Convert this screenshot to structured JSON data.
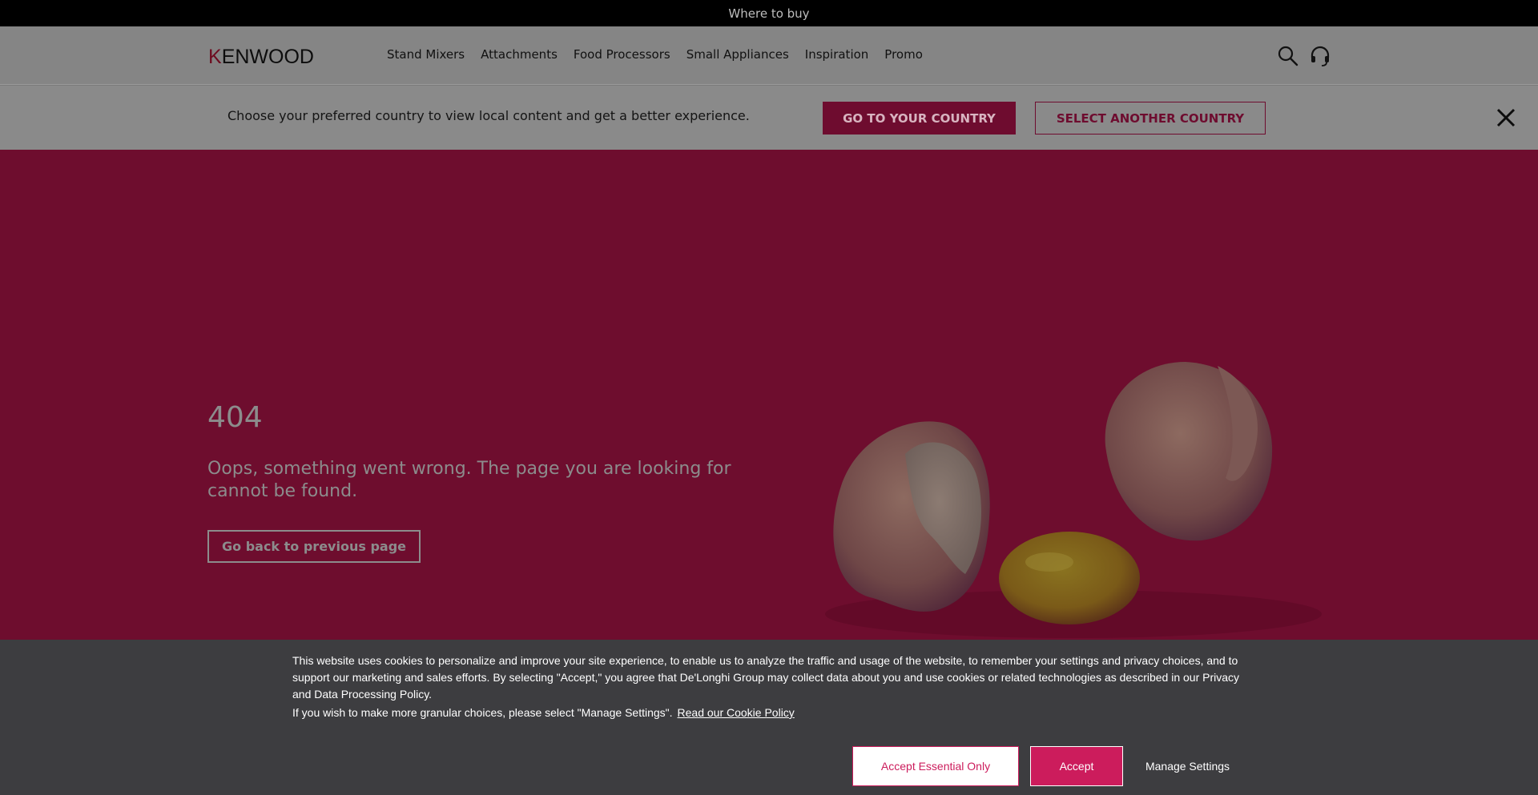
{
  "topbar": {
    "where_to_buy": "Where to buy"
  },
  "header": {
    "logo_k": "K",
    "logo_rest": "ENWOOD",
    "nav": [
      "Stand Mixers",
      "Attachments",
      "Food Processors",
      "Small Appliances",
      "Inspiration",
      "Promo"
    ],
    "icons": [
      "search-icon",
      "headset-icon"
    ]
  },
  "banner": {
    "text": "Choose your preferred country to view local content and get a better experience.",
    "go_label": "GO TO YOUR COUNTRY",
    "select_label": "SELECT ANOTHER COUNTRY"
  },
  "hero": {
    "code": "404",
    "message": "Oops, something went wrong. The page you are looking for cannot be found.",
    "back_label": "Go back to previous page"
  },
  "cookie": {
    "text": "This website uses cookies to personalize and improve your site experience, to enable us to analyze the traffic and usage of the website, to remember your settings and privacy choices, and to support our marketing and sales efforts. By selecting \"Accept,\" you agree that De'Longhi Group may collect data about you and use cookies or related technologies as described in our Privacy and Data Processing Policy.",
    "granular": "If you wish to make more granular choices, please select \"Manage Settings\".",
    "policy_link": "Read our Cookie Policy",
    "essential_label": "Accept Essential Only",
    "accept_label": "Accept",
    "manage_label": "Manage Settings"
  },
  "colors": {
    "brand": "#6e0c2f",
    "accent": "#cc1c5c",
    "cookie_bg": "#3d3d40"
  }
}
